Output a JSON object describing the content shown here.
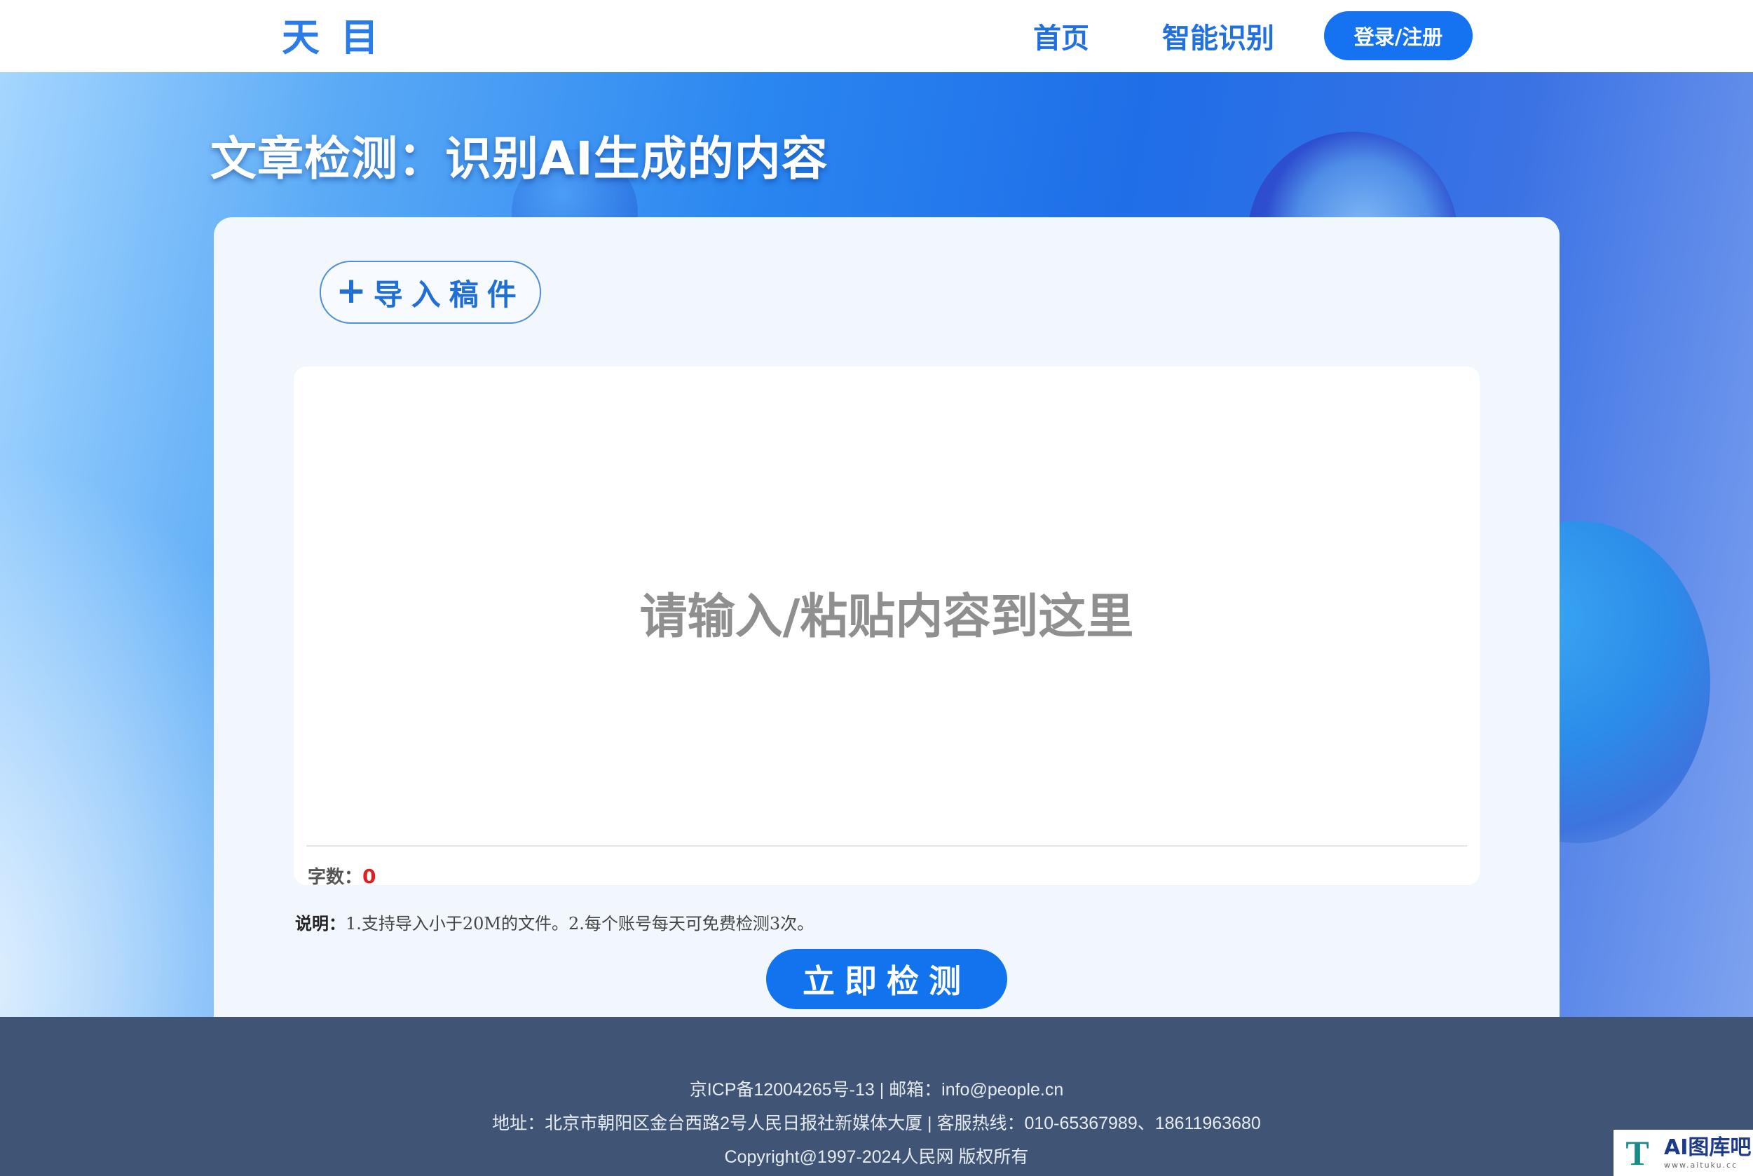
{
  "header": {
    "logo_left": "天",
    "logo_right": "目",
    "nav_home": "首页",
    "nav_ai": "智能识别",
    "login_label": "登录/注册"
  },
  "page_title": "文章检测：识别AI生成的内容",
  "import_button": {
    "icon": "plus-icon",
    "label": "导入稿件"
  },
  "editor": {
    "placeholder": "请输入/粘贴内容到这里",
    "value": ""
  },
  "wordcount": {
    "label": "字数：",
    "value": "0"
  },
  "notes": {
    "label": "说明：",
    "text": "1.支持导入小于20M的文件。2.每个账号每天可免费检测3次。"
  },
  "detect_button": {
    "label": "立即检测"
  },
  "footer": {
    "line1": "京ICP备12004265号-13 | 邮箱：info@people.cn",
    "line2": "地址：北京市朝阳区金台西路2号人民日报社新媒体大厦 | 客服热线：010-65367989、18611963680",
    "line3": "Copyright@1997-2024人民网 版权所有"
  },
  "watermark": {
    "icon": "T",
    "title": "AI图库吧",
    "sub": "www.aituku.cc"
  },
  "colors": {
    "primary": "#1273ee",
    "nav_text": "#2170e0",
    "footer_bg": "#405575",
    "card_bg": "#f1f7fd",
    "wordcount_value": "#e02020"
  }
}
